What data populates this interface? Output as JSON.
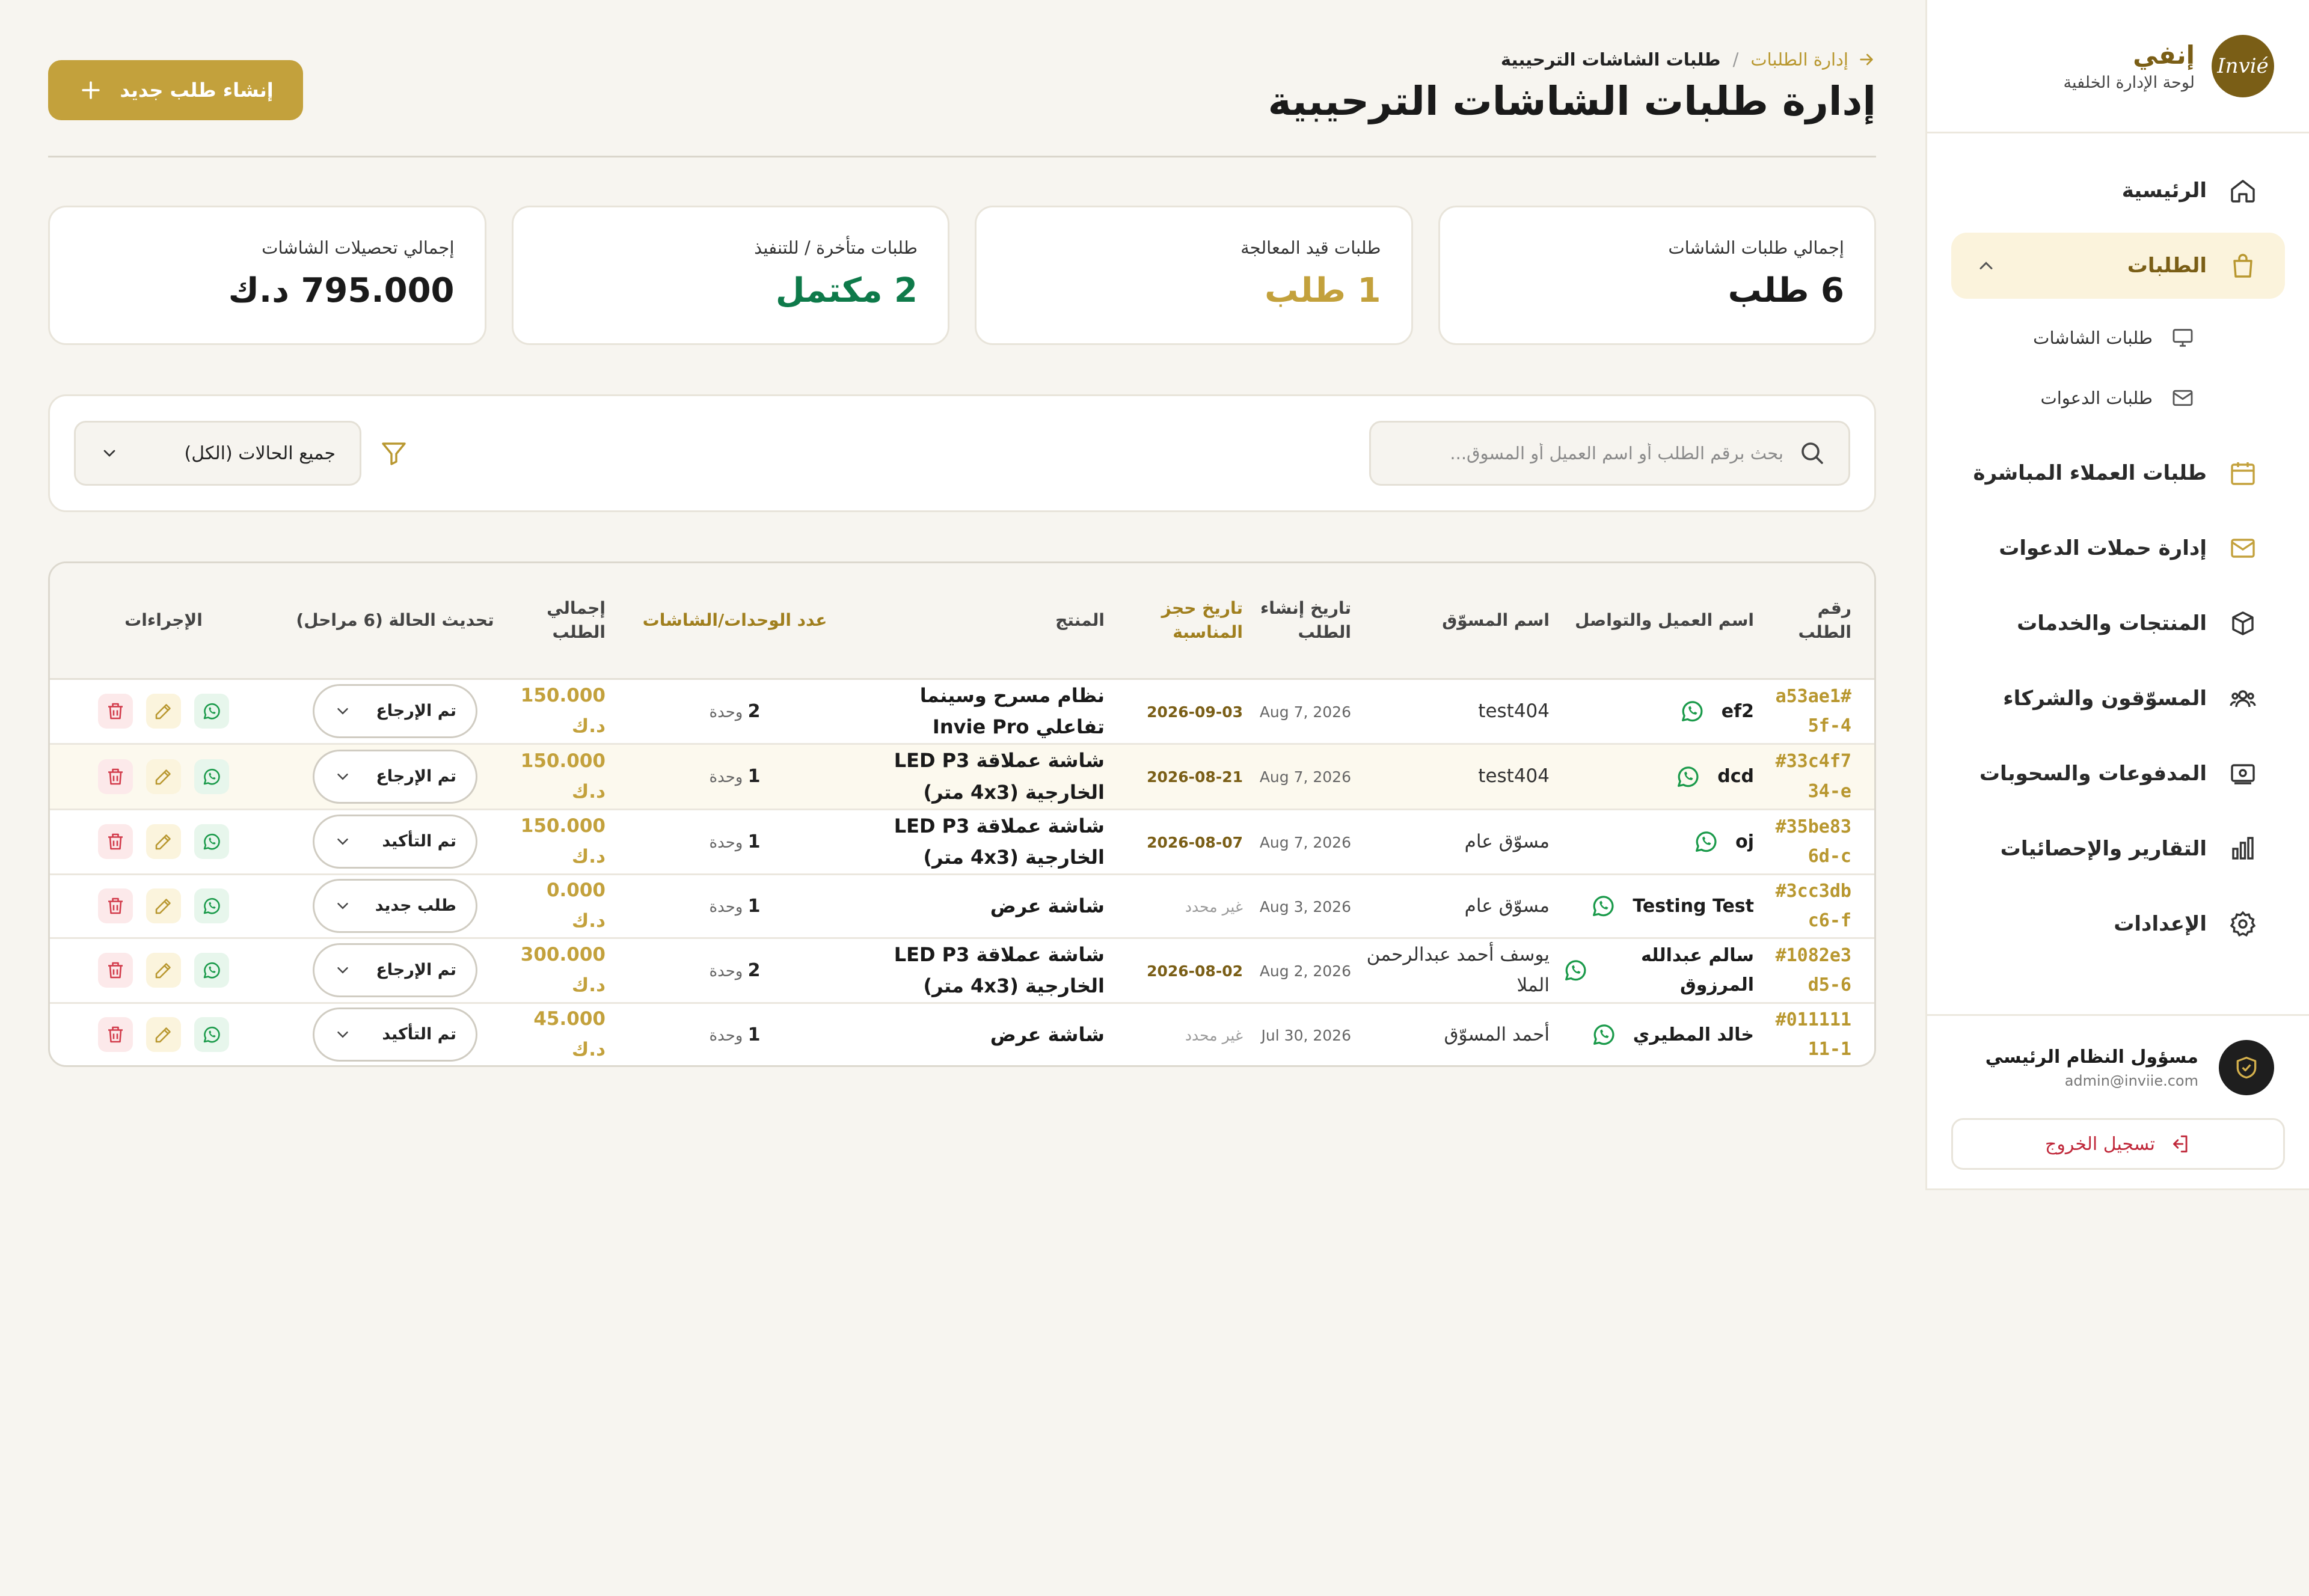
{
  "brand": {
    "logo_text": "Invié",
    "name": "إنفي",
    "subtitle": "لوحة الإدارة الخلفية"
  },
  "nav": {
    "home": "الرئيسية",
    "orders": "الطلبات",
    "screen_orders": "طلبات الشاشات",
    "invite_orders": "طلبات الدعوات",
    "direct_orders": "طلبات العملاء المباشرة",
    "campaigns": "إدارة حملات الدعوات",
    "products": "المنتجات والخدمات",
    "marketers": "المسوّقون والشركاء",
    "payments": "المدفوعات والسحوبات",
    "reports": "التقارير والإحصائيات",
    "settings": "الإعدادات"
  },
  "user": {
    "name": "مسؤول النظام الرئيسي",
    "email": "admin@inviie.com",
    "logout": "تسجيل الخروج"
  },
  "header": {
    "breadcrumb_parent": "إدارة الطلبات",
    "breadcrumb_sep": "/",
    "breadcrumb_current": "طلبات الشاشات الترحيبية",
    "title": "إدارة طلبات الشاشات الترحيبية",
    "create_button": "إنشاء طلب جديد"
  },
  "stats": [
    {
      "label": "إجمالي طلبات الشاشات",
      "value": "6 طلب",
      "color": "#1a1a1a"
    },
    {
      "label": "طلبات قيد المعالجة",
      "value": "1 طلب",
      "color": "#c3a13c"
    },
    {
      "label": "طلبات متأخرة / للتنفيذ",
      "value": "2 مكتمل",
      "color": "#0e7a4a"
    },
    {
      "label": "إجمالي تحصيلات الشاشات",
      "value": "795.000 د.ك",
      "color": "#1a1a1a"
    }
  ],
  "filters": {
    "search_placeholder": "بحث برقم الطلب أو اسم العميل أو المسوق...",
    "status_value": "جميع الحالات (الكل)"
  },
  "table": {
    "headers": {
      "order_no": "رقم الطلب",
      "customer": "اسم العميل والتواصل",
      "marketer": "اسم المسوّق",
      "created": "تاريخ إنشاء الطلب",
      "event_date": "تاريخ حجز المناسبة",
      "product": "المنتج",
      "units": "عدد الوحدات/الشاشات",
      "total": "إجمالي الطلب",
      "status": "تحديث الحالة (6 مراحل)",
      "actions": "الإجراءات"
    },
    "unit_label": "وحدة",
    "rows": [
      {
        "id": "#a53ae15f-4",
        "customer": "ef2",
        "marketer": "test404",
        "created": "Aug 7, 2026",
        "event_date": "2026-09-03",
        "product": "نظام مسرح وسينما تفاعلي Invie Pro",
        "units": "2",
        "total": "150.000 د.ك",
        "status": "تم الإرجاع"
      },
      {
        "id": "#33c4f734-e",
        "customer": "dcd",
        "marketer": "test404",
        "created": "Aug 7, 2026",
        "event_date": "2026-08-21",
        "product": "شاشة عملاقة LED P3 الخارجية (4x3 متر)",
        "units": "1",
        "total": "150.000 د.ك",
        "status": "تم الإرجاع"
      },
      {
        "id": "#35be836d-c",
        "customer": "oj",
        "marketer": "مسوّق عام",
        "created": "Aug 7, 2026",
        "event_date": "2026-08-07",
        "product": "شاشة عملاقة LED P3 الخارجية (4x3 متر)",
        "units": "1",
        "total": "150.000 د.ك",
        "status": "تم التأكيد"
      },
      {
        "id": "#3cc3dbc6-f",
        "customer": "Testing Test",
        "marketer": "مسوّق عام",
        "created": "Aug 3, 2026",
        "event_date": "غير محدد",
        "product": "شاشة عرض",
        "units": "1",
        "total": "0.000 د.ك",
        "status": "طلب جديد"
      },
      {
        "id": "#1082e3d5-6",
        "customer": "سالم عبدالله المرزوق",
        "marketer": "يوسف أحمد عبدالرحمن الملا",
        "created": "Aug 2, 2026",
        "event_date": "2026-08-02",
        "product": "شاشة عملاقة LED P3 الخارجية (4x3 متر)",
        "units": "2",
        "total": "300.000 د.ك",
        "status": "تم الإرجاع"
      },
      {
        "id": "#01111111-1",
        "customer": "خالد المطيري",
        "marketer": "أحمد المسوّق",
        "created": "Jul 30, 2026",
        "event_date": "غير محدد",
        "product": "شاشة عرض",
        "units": "1",
        "total": "45.000 د.ك",
        "status": "تم التأكيد"
      }
    ]
  }
}
